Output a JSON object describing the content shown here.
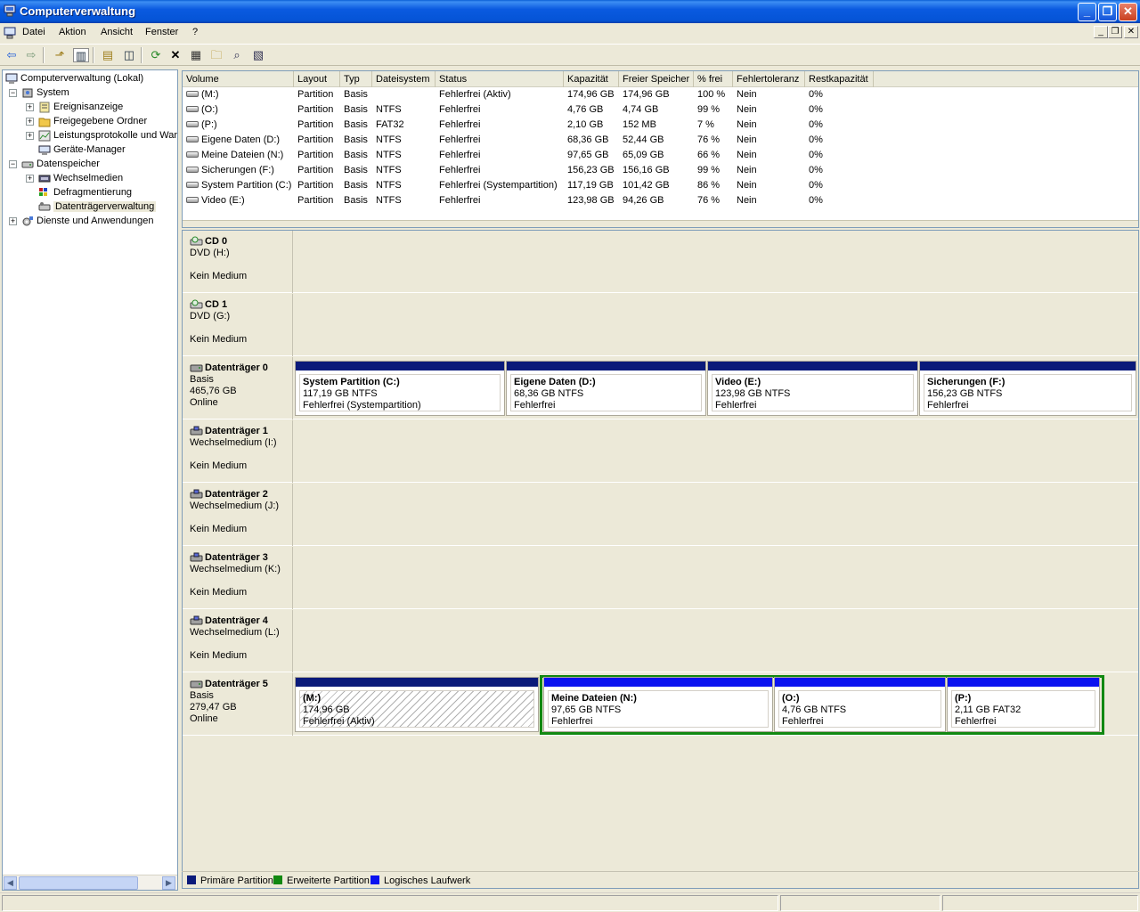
{
  "window": {
    "title": "Computerverwaltung",
    "accent": "#0a5ae0",
    "controls": {
      "minimize": "_",
      "maximize": "❐",
      "close": "✕"
    }
  },
  "menu": {
    "items": [
      "Datei",
      "Aktion",
      "Ansicht",
      "Fenster",
      "?"
    ]
  },
  "tree": {
    "root": "Computerverwaltung (Lokal)",
    "system": "System",
    "ereignisanzeige": "Ereignisanzeige",
    "freigegebene_ordner": "Freigegebene Ordner",
    "leistungsprotokolle": "Leistungsprotokolle und War",
    "geraete_manager": "Geräte-Manager",
    "datenspeicher": "Datenspeicher",
    "wechselmedien": "Wechselmedien",
    "defragmentierung": "Defragmentierung",
    "datentraegerverwaltung": "Datenträgerverwaltung",
    "dienste": "Dienste und Anwendungen"
  },
  "volume_table": {
    "columns": [
      "Volume",
      "Layout",
      "Typ",
      "Dateisystem",
      "Status",
      "Kapazität",
      "Freier Speicher",
      "% frei",
      "Fehlertoleranz",
      "Restkapazität"
    ],
    "rows": [
      [
        "(M:)",
        "Partition",
        "Basis",
        "",
        "Fehlerfrei (Aktiv)",
        "174,96 GB",
        "174,96 GB",
        "100 %",
        "Nein",
        "0%"
      ],
      [
        "(O:)",
        "Partition",
        "Basis",
        "NTFS",
        "Fehlerfrei",
        "4,76 GB",
        "4,74 GB",
        "99 %",
        "Nein",
        "0%"
      ],
      [
        "(P:)",
        "Partition",
        "Basis",
        "FAT32",
        "Fehlerfrei",
        "2,10 GB",
        "152 MB",
        "7 %",
        "Nein",
        "0%"
      ],
      [
        "Eigene Daten (D:)",
        "Partition",
        "Basis",
        "NTFS",
        "Fehlerfrei",
        "68,36 GB",
        "52,44 GB",
        "76 %",
        "Nein",
        "0%"
      ],
      [
        "Meine Dateien (N:)",
        "Partition",
        "Basis",
        "NTFS",
        "Fehlerfrei",
        "97,65 GB",
        "65,09 GB",
        "66 %",
        "Nein",
        "0%"
      ],
      [
        "Sicherungen (F:)",
        "Partition",
        "Basis",
        "NTFS",
        "Fehlerfrei",
        "156,23 GB",
        "156,16 GB",
        "99 %",
        "Nein",
        "0%"
      ],
      [
        "System Partition (C:)",
        "Partition",
        "Basis",
        "NTFS",
        "Fehlerfrei (Systempartition)",
        "117,19 GB",
        "101,42 GB",
        "86 %",
        "Nein",
        "0%"
      ],
      [
        "Video (E:)",
        "Partition",
        "Basis",
        "NTFS",
        "Fehlerfrei",
        "123,98 GB",
        "94,26 GB",
        "76 %",
        "Nein",
        "0%"
      ]
    ]
  },
  "disks": {
    "cd0": {
      "name": "CD 0",
      "type": "DVD (H:)",
      "status": "Kein Medium"
    },
    "cd1": {
      "name": "CD 1",
      "type": "DVD (G:)",
      "status": "Kein Medium"
    },
    "d0": {
      "name": "Datenträger 0",
      "type": "Basis",
      "size": "465,76 GB",
      "status": "Online",
      "partitions": [
        {
          "name": "System Partition  (C:)",
          "size": "117,19 GB NTFS",
          "status": "Fehlerfrei (Systempartition)"
        },
        {
          "name": "Eigene Daten  (D:)",
          "size": "68,36 GB NTFS",
          "status": "Fehlerfrei"
        },
        {
          "name": "Video  (E:)",
          "size": "123,98 GB NTFS",
          "status": "Fehlerfrei"
        },
        {
          "name": "Sicherungen  (F:)",
          "size": "156,23 GB NTFS",
          "status": "Fehlerfrei"
        }
      ]
    },
    "d1": {
      "name": "Datenträger 1",
      "type": "Wechselmedium (I:)",
      "status": "Kein Medium"
    },
    "d2": {
      "name": "Datenträger 2",
      "type": "Wechselmedium (J:)",
      "status": "Kein Medium"
    },
    "d3": {
      "name": "Datenträger 3",
      "type": "Wechselmedium (K:)",
      "status": "Kein Medium"
    },
    "d4": {
      "name": "Datenträger 4",
      "type": "Wechselmedium (L:)",
      "status": "Kein Medium"
    },
    "d5": {
      "name": "Datenträger 5",
      "type": "Basis",
      "size": "279,47 GB",
      "status": "Online",
      "partitions": [
        {
          "name": "(M:)",
          "size": "174,96 GB",
          "status": "Fehlerfrei (Aktiv)"
        },
        {
          "name": "Meine Dateien  (N:)",
          "size": "97,65 GB NTFS",
          "status": "Fehlerfrei"
        },
        {
          "name": "(O:)",
          "size": "4,76 GB NTFS",
          "status": "Fehlerfrei"
        },
        {
          "name": "(P:)",
          "size": "2,11 GB FAT32",
          "status": "Fehlerfrei"
        }
      ]
    }
  },
  "legend": {
    "primary": "Primäre Partition",
    "extended": "Erweiterte Partition",
    "logical": "Logisches Laufwerk"
  },
  "colors": {
    "primary": "#0a1a7a",
    "extended": "#118811",
    "logical": "#0a12f0"
  }
}
